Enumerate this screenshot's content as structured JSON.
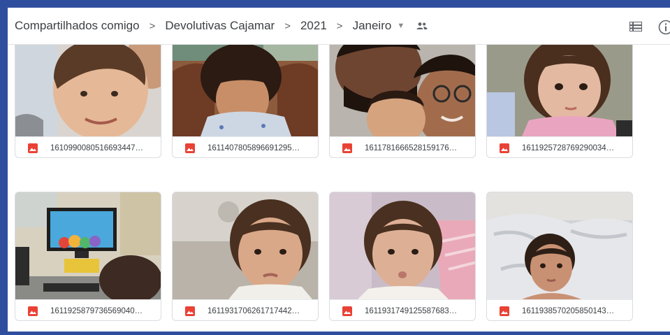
{
  "breadcrumb": {
    "items": [
      "Compartilhados comigo",
      "Devolutivas Cajamar",
      "2021",
      "Janeiro"
    ],
    "separator": ">",
    "dropdown_glyph": "▼"
  },
  "icons": {
    "shared": "people-icon",
    "view_toggle": "list-view-icon",
    "details": "info-icon",
    "file_type": "image-file-icon"
  },
  "colors": {
    "frame_border": "#2f4f9e",
    "image_icon": "#e94235",
    "text": "#3c4043"
  },
  "files": [
    {
      "name": "1610990080516693447…"
    },
    {
      "name": "1611407805896691295…"
    },
    {
      "name": "1611781666528159176…"
    },
    {
      "name": "1611925728769290034…"
    },
    {
      "name": "1611925879736569040…"
    },
    {
      "name": "1611931706261717442…"
    },
    {
      "name": "1611931749125587683…"
    },
    {
      "name": "1611938570205850143…"
    }
  ]
}
